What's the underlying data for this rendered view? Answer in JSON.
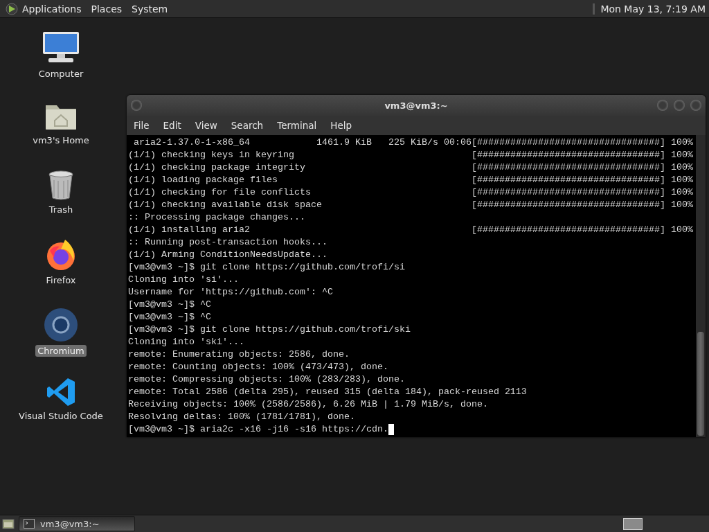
{
  "top_panel": {
    "menus": [
      "Applications",
      "Places",
      "System"
    ],
    "clock": "Mon May 13,  7:19 AM"
  },
  "desktop_icons": [
    {
      "kind": "computer",
      "label": "Computer",
      "selected": false
    },
    {
      "kind": "home",
      "label": "vm3's Home",
      "selected": false
    },
    {
      "kind": "trash",
      "label": "Trash",
      "selected": false
    },
    {
      "kind": "firefox",
      "label": "Firefox",
      "selected": false
    },
    {
      "kind": "chromium",
      "label": "Chromium",
      "selected": true
    },
    {
      "kind": "vscode",
      "label": "Visual Studio Code",
      "selected": false
    }
  ],
  "window": {
    "title": "vm3@vm3:~",
    "menu": [
      "File",
      "Edit",
      "View",
      "Search",
      "Terminal",
      "Help"
    ],
    "lines": [
      {
        "kind": "progress",
        "text": " aria2-1.37.0-1-x86_64            1461.9 KiB   225 KiB/s 00:06",
        "bar": "[#################################]",
        "percent": "100%"
      },
      {
        "kind": "progress",
        "text": "(1/1) checking keys in keyring",
        "bar": "[#################################]",
        "percent": "100%"
      },
      {
        "kind": "progress",
        "text": "(1/1) checking package integrity",
        "bar": "[#################################]",
        "percent": "100%"
      },
      {
        "kind": "progress",
        "text": "(1/1) loading package files",
        "bar": "[#################################]",
        "percent": "100%"
      },
      {
        "kind": "progress",
        "text": "(1/1) checking for file conflicts",
        "bar": "[#################################]",
        "percent": "100%"
      },
      {
        "kind": "progress",
        "text": "(1/1) checking available disk space",
        "bar": "[#################################]",
        "percent": "100%"
      },
      {
        "kind": "plain",
        "text": ":: Processing package changes..."
      },
      {
        "kind": "progress",
        "text": "(1/1) installing aria2",
        "bar": "[#################################]",
        "percent": "100%"
      },
      {
        "kind": "plain",
        "text": ":: Running post-transaction hooks..."
      },
      {
        "kind": "plain",
        "text": "(1/1) Arming ConditionNeedsUpdate..."
      },
      {
        "kind": "plain",
        "text": "[vm3@vm3 ~]$ git clone https://github.com/trofi/si"
      },
      {
        "kind": "plain",
        "text": "Cloning into 'si'..."
      },
      {
        "kind": "plain",
        "text": "Username for 'https://github.com': ^C"
      },
      {
        "kind": "plain",
        "text": "[vm3@vm3 ~]$ ^C"
      },
      {
        "kind": "plain",
        "text": "[vm3@vm3 ~]$ ^C"
      },
      {
        "kind": "plain",
        "text": "[vm3@vm3 ~]$ git clone https://github.com/trofi/ski"
      },
      {
        "kind": "plain",
        "text": "Cloning into 'ski'..."
      },
      {
        "kind": "plain",
        "text": "remote: Enumerating objects: 2586, done."
      },
      {
        "kind": "plain",
        "text": "remote: Counting objects: 100% (473/473), done."
      },
      {
        "kind": "plain",
        "text": "remote: Compressing objects: 100% (283/283), done."
      },
      {
        "kind": "plain",
        "text": "remote: Total 2586 (delta 295), reused 315 (delta 184), pack-reused 2113"
      },
      {
        "kind": "plain",
        "text": "Receiving objects: 100% (2586/2586), 6.26 MiB | 1.79 MiB/s, done."
      },
      {
        "kind": "plain",
        "text": "Resolving deltas: 100% (1781/1781), done."
      },
      {
        "kind": "prompt",
        "text": "[vm3@vm3 ~]$ aria2c -x16 -j16 -s16 https://cdn.",
        "cursor": true
      }
    ]
  },
  "taskbar": {
    "tasks": [
      {
        "label": "vm3@vm3:~",
        "selected": true
      }
    ]
  }
}
